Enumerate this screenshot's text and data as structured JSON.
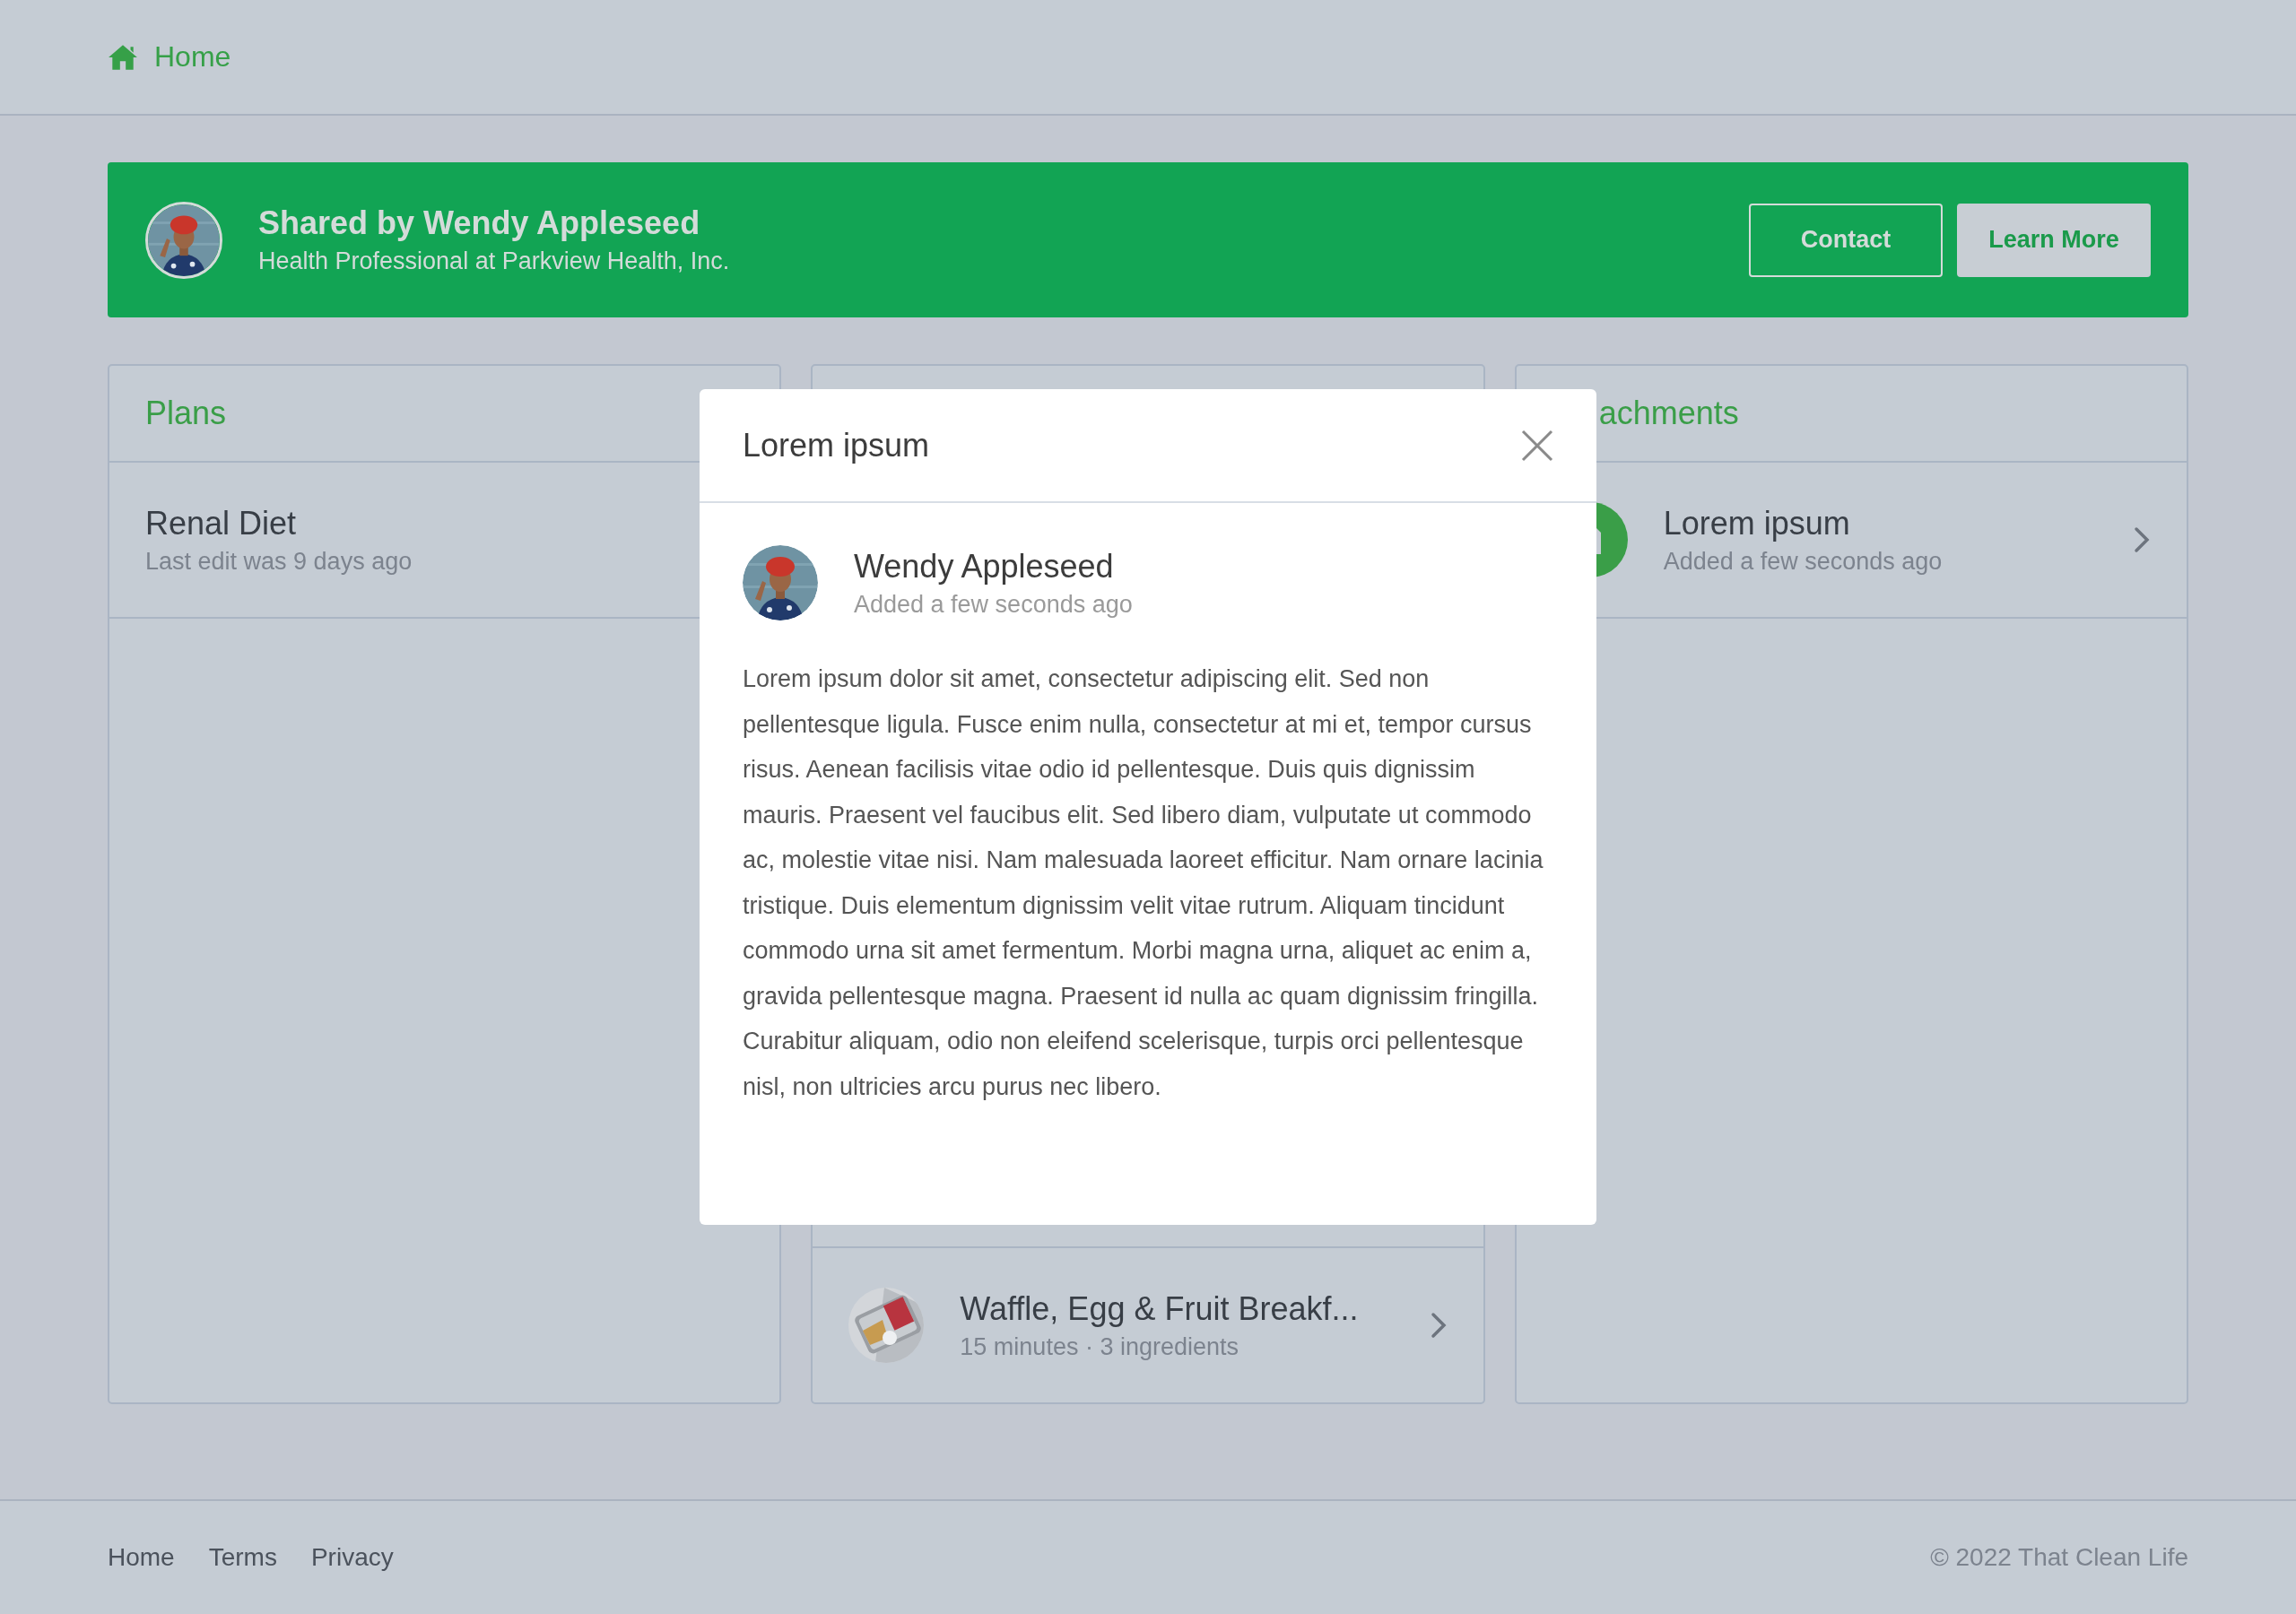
{
  "nav": {
    "home": "Home"
  },
  "banner": {
    "title": "Shared by Wendy Appleseed",
    "subtitle": "Health Professional at Parkview Health, Inc.",
    "buttons": [
      {
        "label": "Contact",
        "kind": "outline"
      },
      {
        "label": "Learn More",
        "kind": "solid"
      }
    ]
  },
  "cards": [
    {
      "title": "Plans",
      "items": [
        {
          "kind": "plan",
          "title": "Renal Diet",
          "subtitle": "Last edit was 9 days ago"
        }
      ]
    },
    {
      "items": [
        {
          "kind": "recipe",
          "title": "Waffle, Egg & Fruit Breakf...",
          "subtitle": "15 minutes · 3 ingredients"
        }
      ]
    },
    {
      "title": "achments",
      "items": [
        {
          "kind": "attachment",
          "title": "Lorem ipsum",
          "subtitle": "Added a few seconds ago"
        }
      ]
    }
  ],
  "modal": {
    "title": "Lorem ipsum",
    "author": "Wendy Appleseed",
    "time": "Added a few seconds ago",
    "body": "Lorem ipsum dolor sit amet, consectetur adipiscing elit. Sed non pellentesque ligula. Fusce enim nulla, consectetur at mi et, tempor cursus risus. Aenean facilisis vitae odio id pellentesque. Duis quis dignissim mauris. Praesent vel faucibus elit. Sed libero diam, vulputate ut commodo ac, molestie vitae nisi. Nam malesuada laoreet efficitur. Nam ornare lacinia tristique. Duis elementum dignissim velit vitae rutrum. Aliquam tincidunt commodo urna sit amet fermentum. Morbi magna urna, aliquet ac enim a, gravida pellentesque magna. Praesent id nulla ac quam dignissim fringilla. Curabitur aliquam, odio non eleifend scelerisque, turpis orci pellentesque nisl, non ultricies arcu purus nec libero."
  },
  "footer": {
    "links": [
      "Home",
      "Terms",
      "Privacy"
    ],
    "copyright": "© 2022 That Clean Life"
  }
}
